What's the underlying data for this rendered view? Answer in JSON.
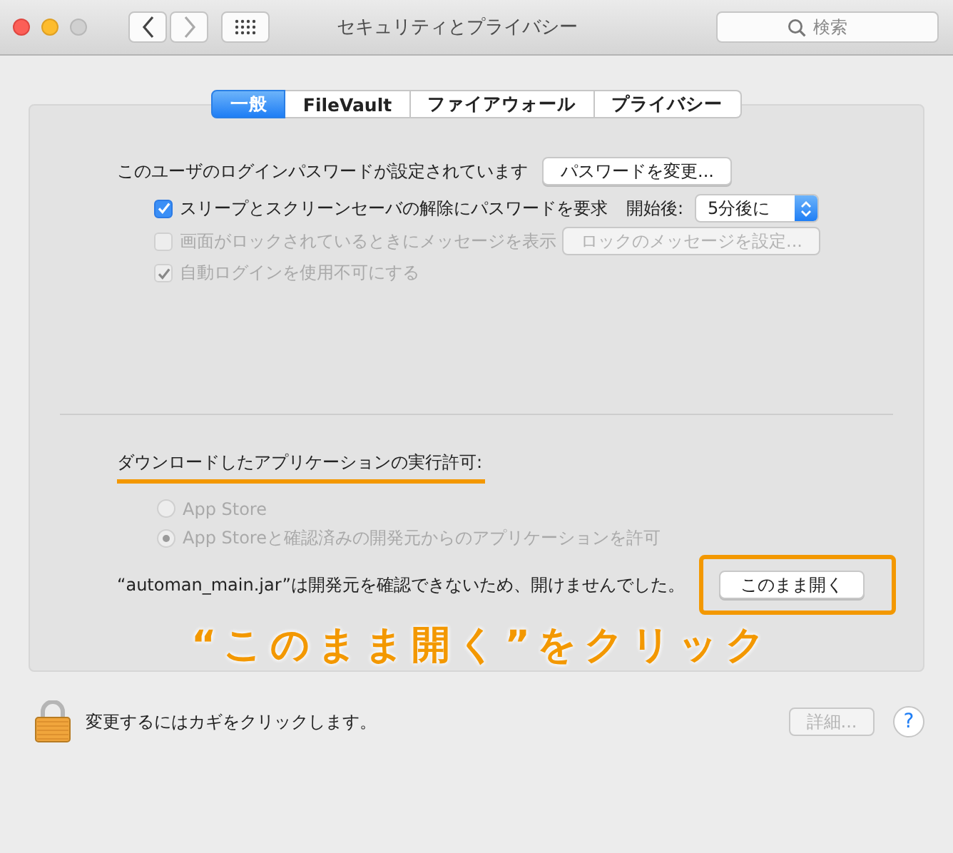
{
  "window": {
    "title": "セキュリティとプライバシー",
    "search": {
      "placeholder": "検索"
    }
  },
  "tabs": [
    {
      "label": "一般",
      "selected": true
    },
    {
      "label": "FileVault",
      "selected": false
    },
    {
      "label": "ファイアウォール",
      "selected": false
    },
    {
      "label": "プライバシー",
      "selected": false
    }
  ],
  "general": {
    "password_text": "このユーザのログインパスワードが設定されています",
    "change_password_button": "パスワードを変更...",
    "options": [
      {
        "kind": "popup",
        "label": "スリープとスクリーンセーバの解除にパスワードを要求",
        "checked": true,
        "disabled": false,
        "popup_label": "開始後:",
        "popup_value": "5分後に"
      },
      {
        "kind": "button",
        "label": "画面がロックされているときにメッセージを表示",
        "checked": false,
        "disabled": true,
        "button": "ロックのメッセージを設定...",
        "button_disabled": true
      },
      {
        "kind": "plain",
        "label": "自動ログインを使用不可にする",
        "checked": true,
        "disabled": true
      }
    ]
  },
  "downloads": {
    "heading": "ダウンロードしたアプリケーションの実行許可:",
    "radios": [
      {
        "label": "App Store",
        "selected": false,
        "disabled": true
      },
      {
        "label": "App Storeと確認済みの開発元からのアプリケーションを許可",
        "selected": true,
        "disabled": true
      }
    ],
    "blocked_message": "“automan_main.jar”は開発元を確認できないため、開けませんでした。",
    "open_anyway_button": "このまま開く"
  },
  "annotation": {
    "text": "“このまま開く”をクリック"
  },
  "footer": {
    "lock_text": "変更するにはカギをクリックします。",
    "advanced_button": {
      "label": "詳細...",
      "disabled": true
    },
    "help": "?"
  }
}
